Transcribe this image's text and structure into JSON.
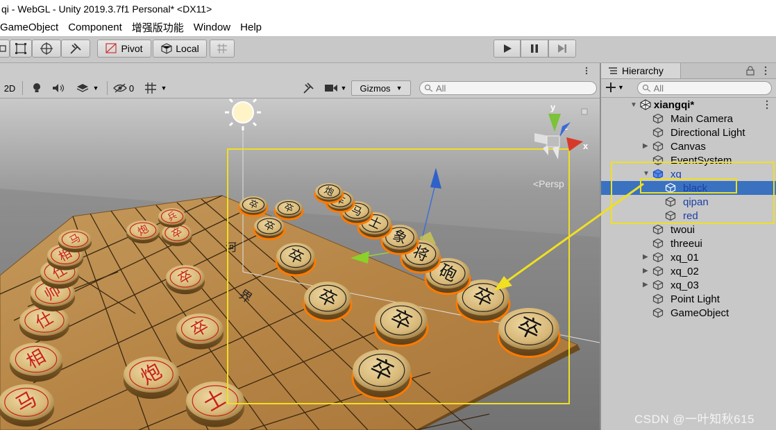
{
  "window": {
    "title": "qi - WebGL - Unity 2019.3.7f1 Personal* <DX11>"
  },
  "menu": [
    "GameObject",
    "Component",
    "增强版功能",
    "Window",
    "Help"
  ],
  "toolbar": {
    "pivot_label": "Pivot",
    "local_label": "Local"
  },
  "scene": {
    "mode_2d": "2D",
    "hidden_count": "0",
    "gizmos_label": "Gizmos",
    "search_placeholder": "All",
    "persp_label": "<Persp",
    "axis_y": "y",
    "axis_z": "z",
    "axis_x": "x",
    "board_text_1": "河",
    "board_text_2": "界"
  },
  "pieces": {
    "red": [
      "马",
      "相",
      "仕",
      "帅",
      "仕",
      "相",
      "马",
      "炮",
      "炮",
      "卒",
      "卒",
      "卒",
      "士",
      "兵"
    ],
    "black": [
      "卒",
      "卒",
      "卒",
      "卒",
      "卒",
      "砲",
      "将",
      "象",
      "士",
      "马",
      "车",
      "炮",
      "卒"
    ]
  },
  "hierarchy": {
    "tab_label": "Hierarchy",
    "search_placeholder": "All",
    "scene_name": "xiangqi*",
    "items": [
      {
        "label": "Main Camera",
        "indent": 1,
        "expand": ""
      },
      {
        "label": "Directional Light",
        "indent": 1,
        "expand": ""
      },
      {
        "label": "Canvas",
        "indent": 1,
        "expand": "▶"
      },
      {
        "label": "EventSystem",
        "indent": 1,
        "expand": ""
      },
      {
        "label": "xq",
        "indent": 1,
        "expand": "▼"
      },
      {
        "label": "black",
        "indent": 2,
        "expand": ""
      },
      {
        "label": "qipan",
        "indent": 2,
        "expand": ""
      },
      {
        "label": "red",
        "indent": 2,
        "expand": ""
      },
      {
        "label": "twoui",
        "indent": 1,
        "expand": ""
      },
      {
        "label": "threeui",
        "indent": 1,
        "expand": ""
      },
      {
        "label": "xq_01",
        "indent": 1,
        "expand": "▶"
      },
      {
        "label": "xq_02",
        "indent": 1,
        "expand": "▶"
      },
      {
        "label": "xq_03",
        "indent": 1,
        "expand": "▶"
      },
      {
        "label": "Point Light",
        "indent": 1,
        "expand": ""
      },
      {
        "label": "GameObject",
        "indent": 1,
        "expand": ""
      }
    ]
  },
  "watermark": "CSDN @一叶知秋615",
  "colors": {
    "selection": "#3a72c0",
    "highlight_box": "#f0e020",
    "piece_outline": "#ff7a00",
    "red_text": "#c8201a"
  }
}
